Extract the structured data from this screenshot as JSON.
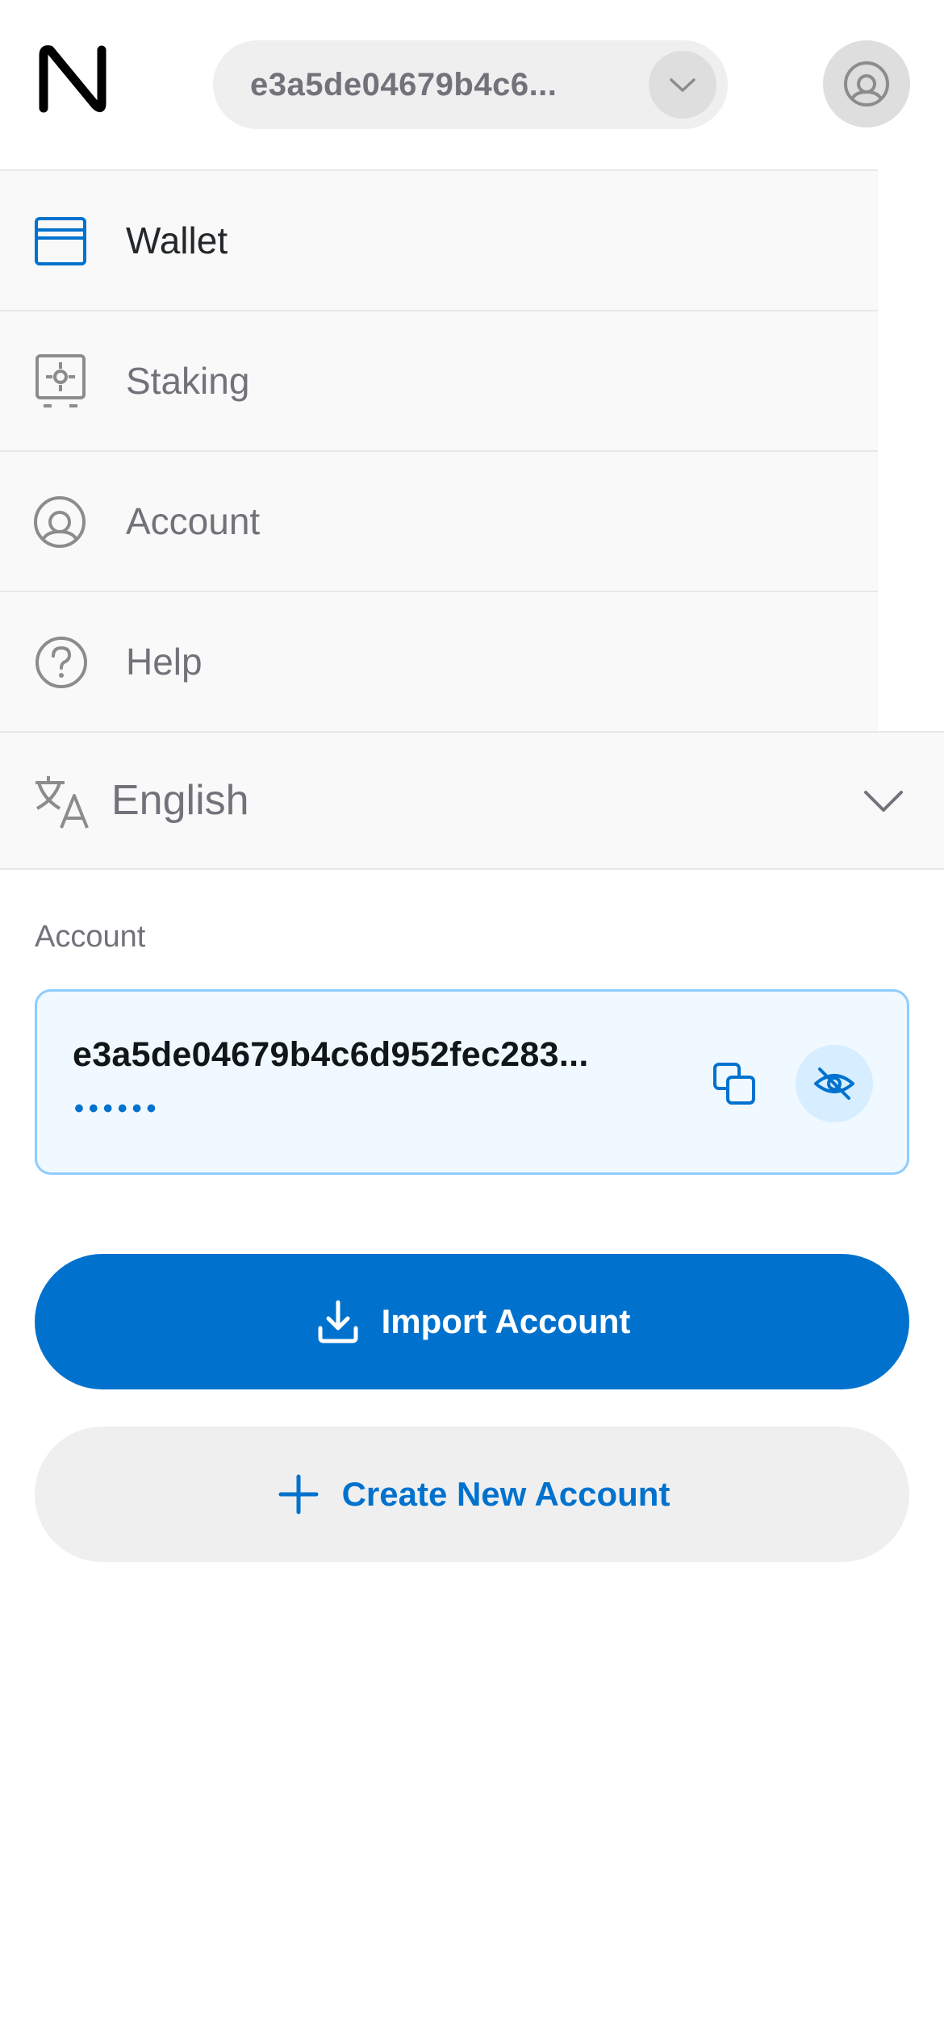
{
  "header": {
    "account_short": "e3a5de04679b4c6..."
  },
  "nav": {
    "items": [
      {
        "label": "Wallet",
        "icon": "wallet-icon",
        "active": true
      },
      {
        "label": "Staking",
        "icon": "staking-icon",
        "active": false
      },
      {
        "label": "Account",
        "icon": "account-icon",
        "active": false
      },
      {
        "label": "Help",
        "icon": "help-icon",
        "active": false
      }
    ]
  },
  "language": {
    "selected": "English"
  },
  "account_section": {
    "label": "Account",
    "account_id": "e3a5de04679b4c6d952fec283...",
    "balance_masked": "••••••"
  },
  "actions": {
    "import_label": "Import Account",
    "create_label": "Create New Account"
  },
  "colors": {
    "accent": "#0072ce",
    "card_bg": "#f0f9ff",
    "card_border": "#8fcdff",
    "muted_text": "#72727a"
  }
}
